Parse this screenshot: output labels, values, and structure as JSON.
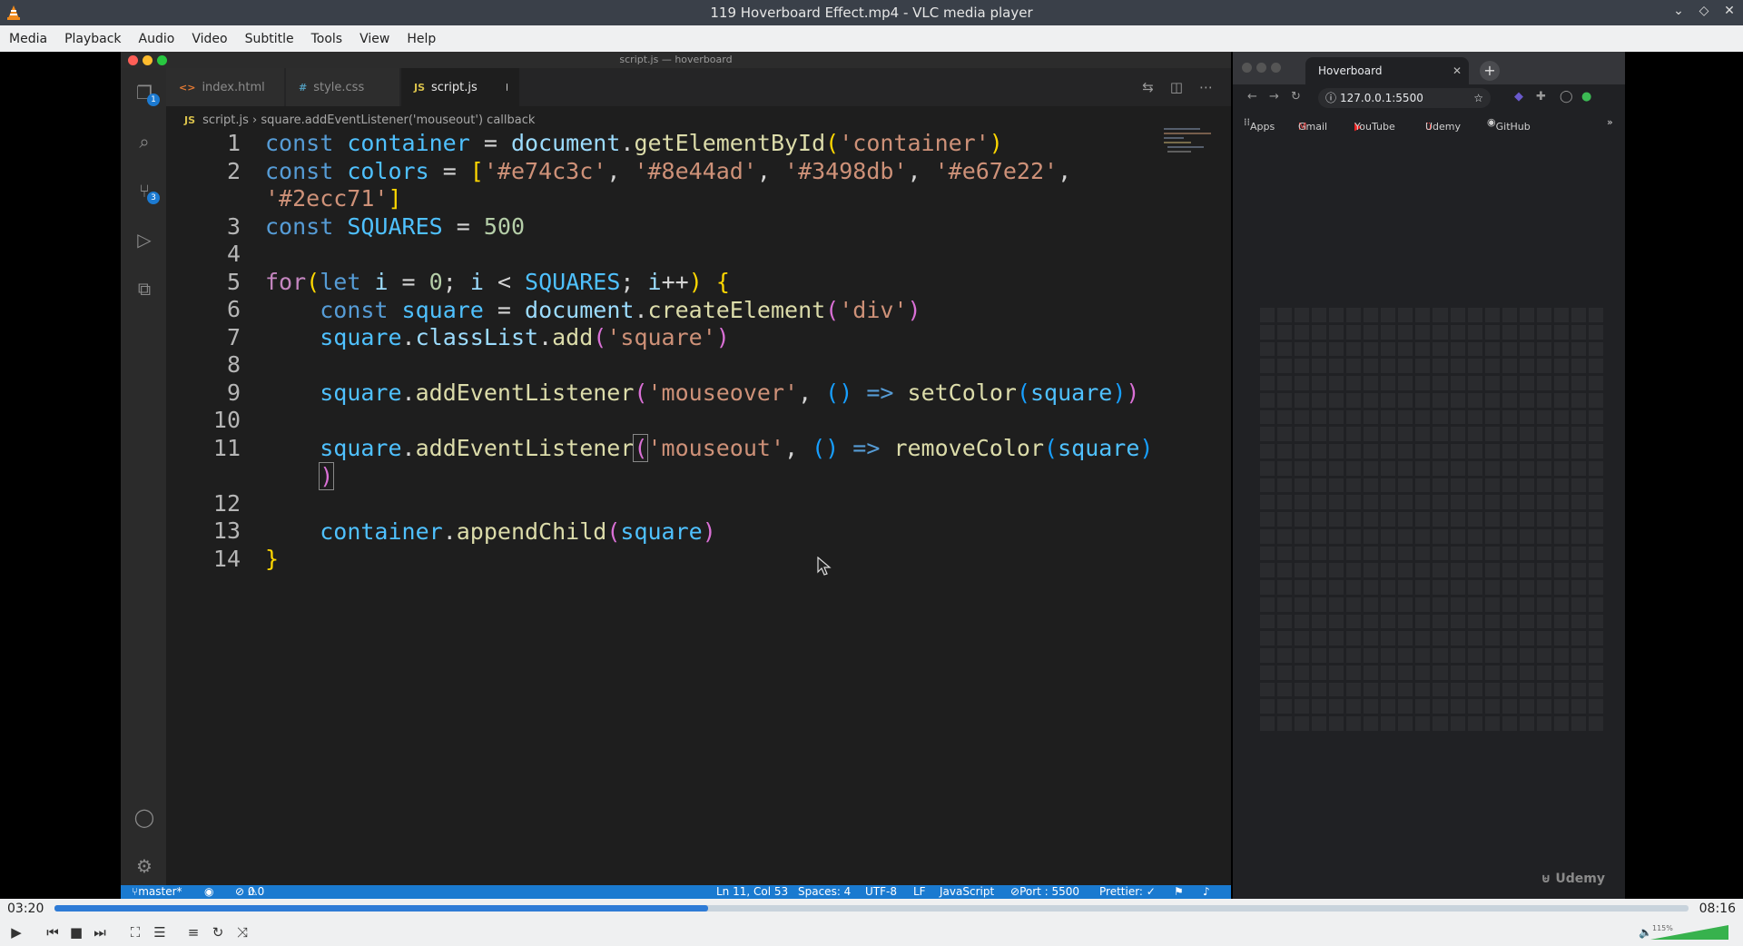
{
  "window": {
    "title": "119 Hoverboard Effect.mp4 - VLC media player"
  },
  "menu": [
    "Media",
    "Playback",
    "Audio",
    "Video",
    "Subtitle",
    "Tools",
    "View",
    "Help"
  ],
  "vscode": {
    "window_title": "script.js — hoverboard",
    "tabs": [
      {
        "icon": "<>",
        "label": "index.html"
      },
      {
        "icon": "#",
        "label": "style.css"
      },
      {
        "icon": "JS",
        "label": "script.js"
      }
    ],
    "badges": {
      "explorer": "1",
      "source_control": "3"
    },
    "breadcrumb": {
      "file": "script.js",
      "symbol": "square.addEventListener('mouseout') callback"
    },
    "line_numbers": [
      "1",
      "2",
      "",
      "3",
      "4",
      "5",
      "6",
      "7",
      "8",
      "9",
      "10",
      "11",
      "",
      "12",
      "13",
      "14"
    ],
    "status": {
      "branch": "master*",
      "errors": "0",
      "warnings": "0",
      "position": "Ln 11, Col 53",
      "spaces": "Spaces: 4",
      "encoding": "UTF-8",
      "eol": "LF",
      "language": "JavaScript",
      "port": "Port : 5500",
      "prettier": "Prettier: ✓"
    }
  },
  "browser": {
    "tab_title": "Hoverboard",
    "url": "127.0.0.1:5500",
    "bookmarks": [
      "Apps",
      "Gmail",
      "YouTube",
      "Udemy",
      "GitHub"
    ],
    "watermark": "Udemy"
  },
  "player": {
    "elapsed": "03:20",
    "total": "08:16",
    "progress": 0.4,
    "volume_label": "115%",
    "volume": 1.15
  }
}
